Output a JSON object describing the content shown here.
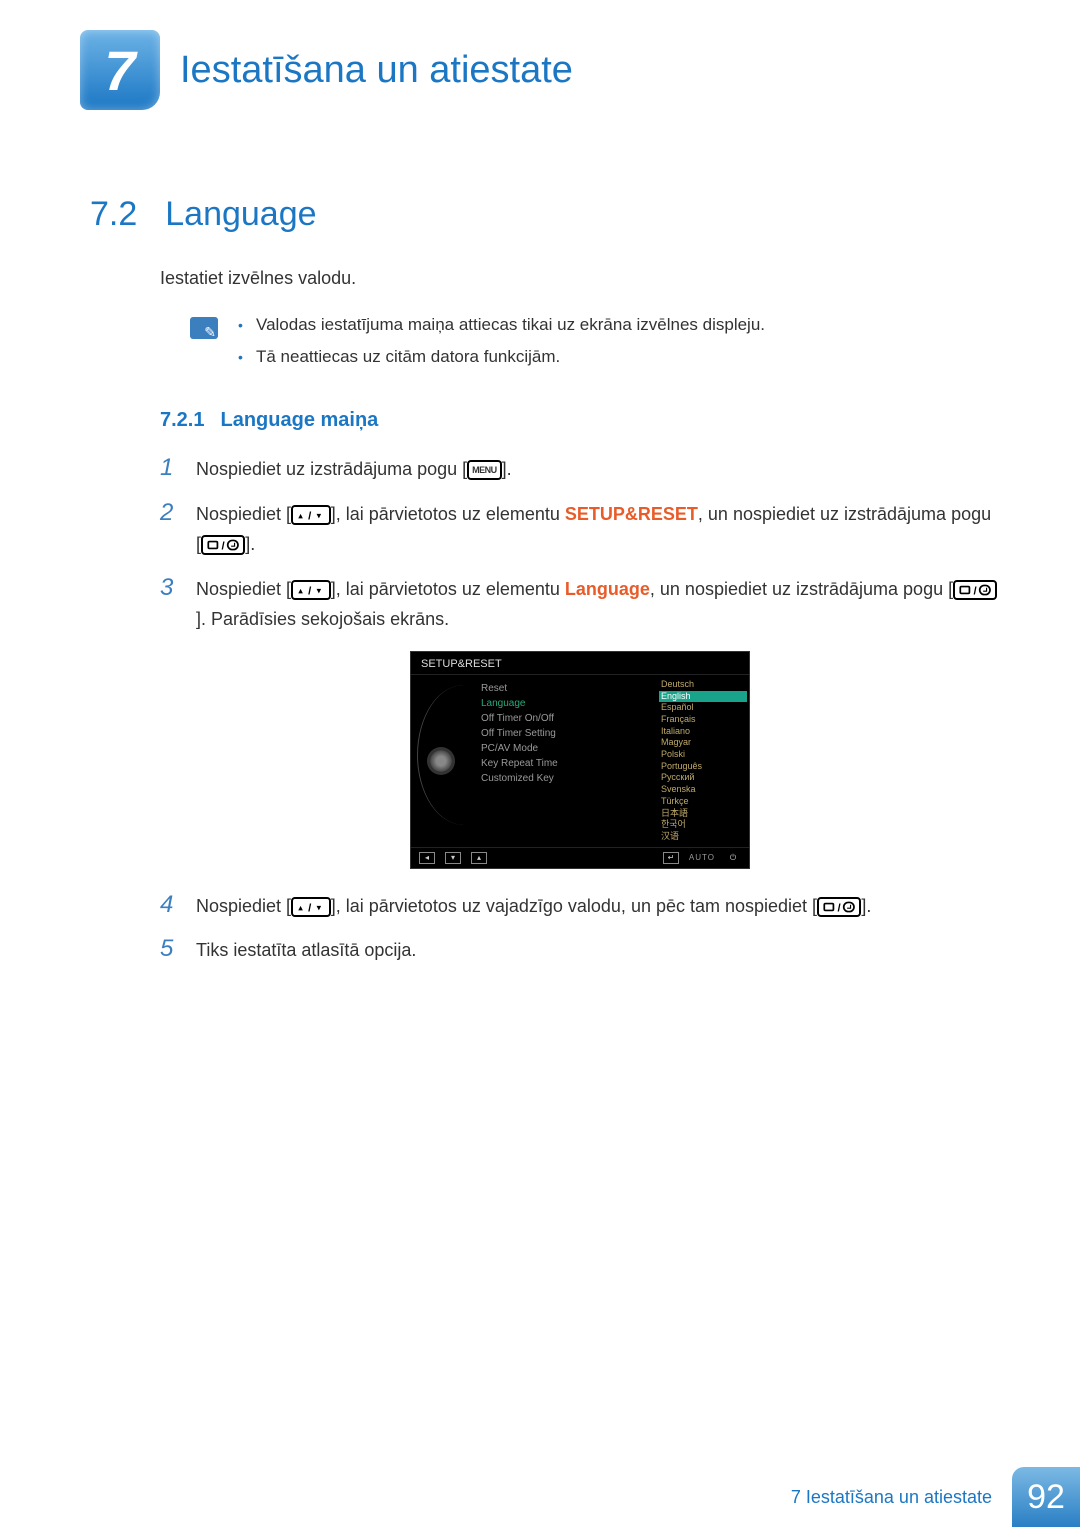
{
  "chapter": {
    "number": "7",
    "title": "Iestatīšana un atiestate"
  },
  "section": {
    "number": "7.2",
    "title": "Language"
  },
  "intro": "Iestatiet izvēlnes valodu.",
  "notes": [
    "Valodas iestatījuma maiņa attiecas tikai uz ekrāna izvēlnes displeju.",
    "Tā neattiecas uz citām datora funkcijām."
  ],
  "subsection": {
    "number": "7.2.1",
    "title": "Language maiņa"
  },
  "steps": {
    "s1_a": "Nospiediet uz izstrādājuma pogu [",
    "s1_b": "].",
    "s2_a": "Nospiediet [",
    "s2_b": "], lai pārvietotos uz elementu ",
    "s2_hl": "SETUP&RESET",
    "s2_c": ", un nospiediet uz izstrādājuma pogu [",
    "s2_d": "].",
    "s3_a": "Nospiediet [",
    "s3_b": "], lai pārvietotos uz elementu ",
    "s3_hl": "Language",
    "s3_c": ", un nospiediet uz izstrādājuma pogu [",
    "s3_d": "]. Parādīsies sekojošais ekrāns.",
    "s4_a": "Nospiediet [",
    "s4_b": "], lai pārvietotos uz vajadzīgo valodu, un pēc tam nospiediet [",
    "s4_c": "].",
    "s5": "Tiks iestatīta atlasītā opcija."
  },
  "step_numbers": [
    "1",
    "2",
    "3",
    "4",
    "5"
  ],
  "menu_label": "MENU",
  "osd": {
    "title": "SETUP&RESET",
    "items": [
      "Reset",
      "Language",
      "Off Timer On/Off",
      "Off Timer Setting",
      "PC/AV Mode",
      "Key Repeat Time",
      "Customized Key"
    ],
    "selected_index": 1,
    "langs": [
      "Deutsch",
      "English",
      "Español",
      "Français",
      "Italiano",
      "Magyar",
      "Polski",
      "Português",
      "Русский",
      "Svenska",
      "Türkçe",
      "日本語",
      "한국어",
      "汉语"
    ],
    "lang_selected_index": 1,
    "auto": "AUTO"
  },
  "footer": {
    "text": "7 Iestatīšana un atiestate",
    "page": "92"
  }
}
